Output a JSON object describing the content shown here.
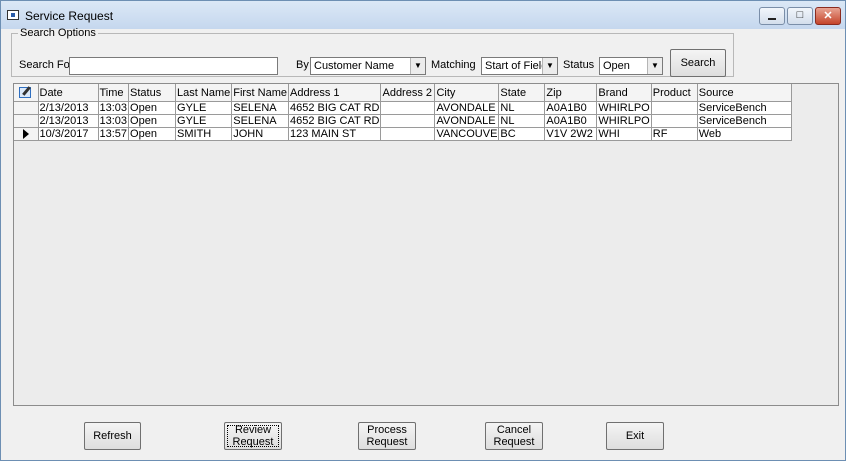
{
  "window": {
    "title": "Service Request",
    "close_glyph": "✕",
    "max_glyph": "□"
  },
  "search": {
    "group_label": "Search Options",
    "search_for_label": "Search For",
    "search_for_value": "",
    "by_label": "By",
    "by_value": "Customer Name",
    "matching_label": "Matching",
    "matching_value": "Start of Field",
    "status_label": "Status",
    "status_value": "Open",
    "search_button": "Search"
  },
  "grid": {
    "columns": [
      "Date",
      "Time",
      "Status",
      "Last Name",
      "First Name",
      "Address 1",
      "Address 2",
      "City",
      "State",
      "Zip",
      "Brand",
      "Product",
      "Source"
    ],
    "rows": [
      [
        "2/13/2013",
        "13:03",
        "Open",
        "GYLE",
        "SELENA",
        "4652 BIG CAT RD",
        "",
        "AVONDALE",
        "NL",
        "A0A1B0",
        "WHIRLPO",
        "",
        "ServiceBench"
      ],
      [
        "2/13/2013",
        "13:03",
        "Open",
        "GYLE",
        "SELENA",
        "4652 BIG CAT RD",
        "",
        "AVONDALE",
        "NL",
        "A0A1B0",
        "WHIRLPO",
        "",
        "ServiceBench"
      ],
      [
        "10/3/2017",
        "13:57",
        "Open",
        "SMITH",
        "JOHN",
        "123 MAIN ST",
        "",
        "VANCOUVE",
        "BC",
        "V1V 2W2",
        "WHI",
        "RF",
        "Web"
      ]
    ],
    "current_row": 2
  },
  "buttons": {
    "refresh": "Refresh",
    "review": "Review\nRequest",
    "process": "Process\nRequest",
    "cancel": "Cancel\nRequest",
    "exit": "Exit"
  }
}
